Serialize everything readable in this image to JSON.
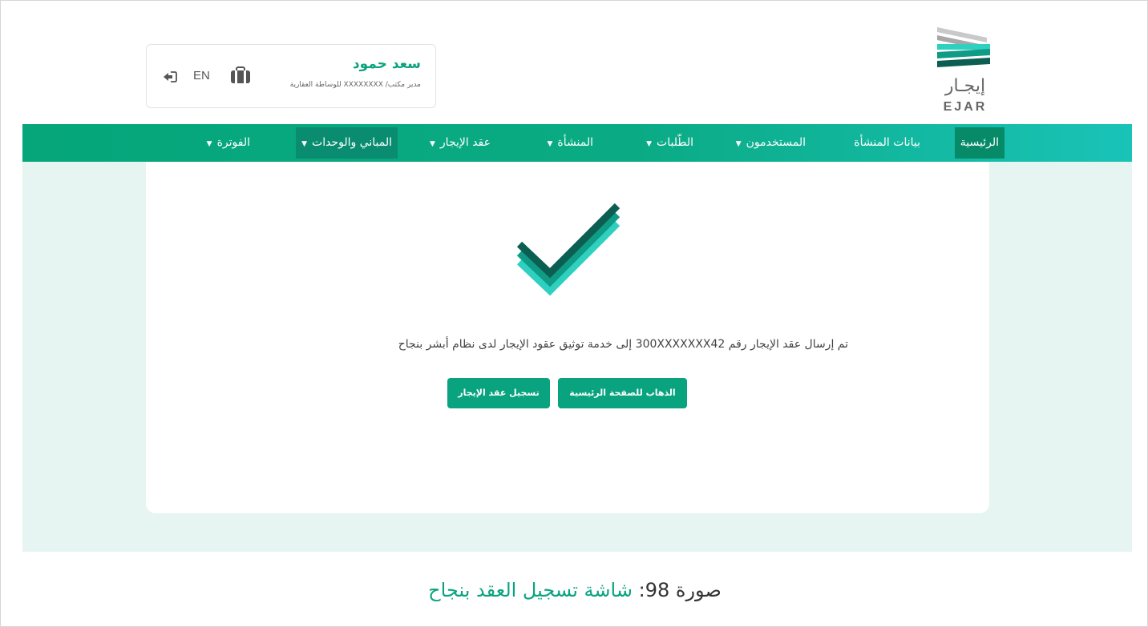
{
  "header": {
    "user_name": "سعد حمود",
    "user_role": "مدير مكتب/ XXXXXXXX للوساطة العقارية",
    "lang_label": "EN",
    "logo_ar": "إيجـار",
    "logo_en": "EJAR"
  },
  "nav": {
    "items": [
      {
        "label": "الرئيسية",
        "has_dropdown": false
      },
      {
        "label": "بيانات المنشأة",
        "has_dropdown": false
      },
      {
        "label": "المستخدمون",
        "has_dropdown": true
      },
      {
        "label": "الطّلبات",
        "has_dropdown": true
      },
      {
        "label": "المنشأة",
        "has_dropdown": true
      },
      {
        "label": "عقد الإيجار",
        "has_dropdown": true
      },
      {
        "label": "المباني والوحدات",
        "has_dropdown": true
      },
      {
        "label": "الفوترة",
        "has_dropdown": true
      }
    ]
  },
  "main": {
    "success_message": "تم إرسال عقد الإيجار رقم 300XXXXXXX42 إلى خدمة توثيق عقود الإيجار لدى نظام أبشر بنجاح",
    "buttons": {
      "go_home": "الذهاب للصفحة الرئيسية",
      "register_contract": "تسجيل عقد الإيجار"
    }
  },
  "caption": {
    "prefix": "صورة 98:",
    "title": "شاشة تسجيل العقد بنجاح"
  },
  "colors": {
    "primary": "#0aa37f",
    "nav_gradient_end": "#19c3b7",
    "content_bg": "#e6f5f1",
    "check_dark": "#0b5e51",
    "check_mid": "#0f9b85",
    "check_light": "#2fd0bf"
  },
  "icons": {
    "logout": "logout-icon",
    "briefcase": "briefcase-icon",
    "dropdown": "caret-down-icon",
    "success": "checkmark-icon"
  }
}
